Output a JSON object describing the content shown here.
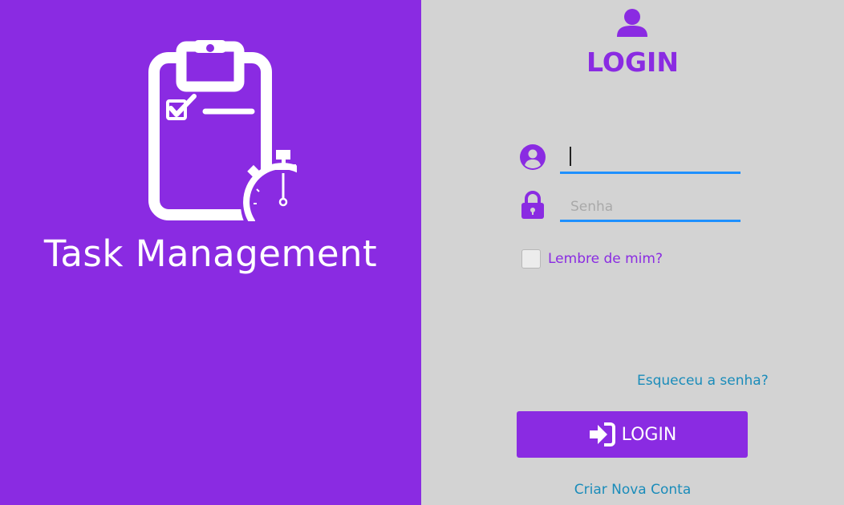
{
  "branding": {
    "app_title": "Task Management",
    "logo_icon": "clipboard-stopwatch-icon",
    "background_color": "#8a2be2"
  },
  "login": {
    "header_icon": "user-icon",
    "heading": "LOGIN",
    "username": {
      "icon": "user-circle-icon",
      "value": "",
      "placeholder": ""
    },
    "password": {
      "icon": "lock-icon",
      "value": "",
      "placeholder": "Senha"
    },
    "remember_label": "Lembre de mim?",
    "remember_checked": false,
    "forgot_link": "Esqueceu a senha?",
    "submit_label": "LOGIN",
    "submit_icon": "sign-in-icon",
    "create_account_link": "Criar Nova Conta"
  },
  "colors": {
    "accent": "#8a2be2",
    "link": "#1a8cba",
    "input_underline": "#1e90ff",
    "panel_gray": "#d3d3d3"
  }
}
